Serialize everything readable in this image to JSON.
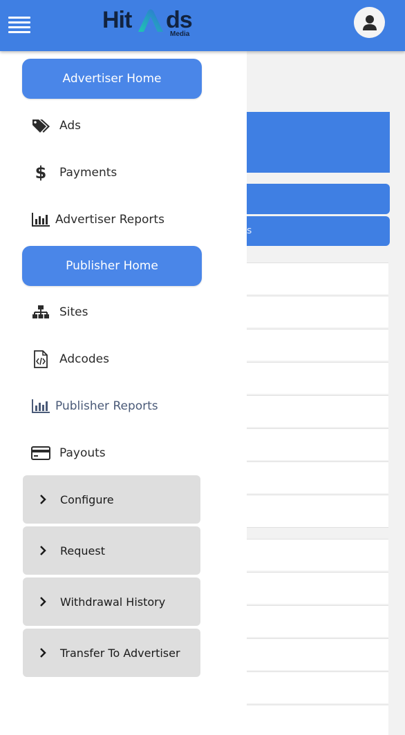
{
  "header": {
    "logo_left": "Hit",
    "logo_right": "ds",
    "logo_sub": "Media"
  },
  "drawer": {
    "advertiser_home": "Advertiser Home",
    "advertiser_items": [
      {
        "label": "Ads",
        "icon": "tags-icon"
      },
      {
        "label": "Payments",
        "icon": "dollar-icon"
      },
      {
        "label": "Advertiser Reports",
        "icon": "bar-chart-icon"
      }
    ],
    "publisher_home": "Publisher Home",
    "publisher_items": [
      {
        "label": "Sites",
        "icon": "sitemap-icon"
      },
      {
        "label": "Adcodes",
        "icon": "code-file-icon"
      },
      {
        "label": "Publisher Reports",
        "icon": "bar-chart-icon"
      },
      {
        "label": "Payouts",
        "icon": "credit-card-icon"
      }
    ],
    "payout_submenu": [
      {
        "label": "Configure"
      },
      {
        "label": "Request"
      },
      {
        "label": "Withdrawal History"
      },
      {
        "label": "Transfer To Advertiser"
      }
    ]
  },
  "background": {
    "partial_text": "s"
  },
  "colors": {
    "primary": "#3f7fe3",
    "button": "#4a86e8",
    "submenu_bg": "#dedede",
    "active_text": "#4a5a78"
  }
}
